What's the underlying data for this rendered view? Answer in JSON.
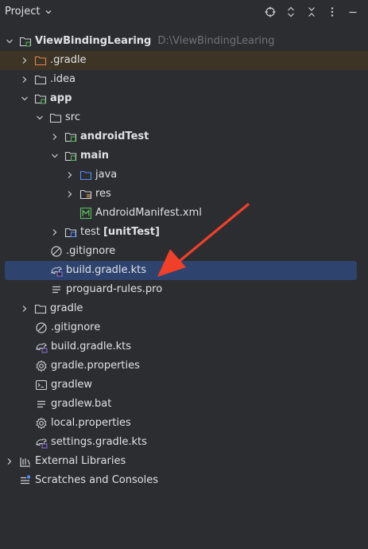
{
  "header": {
    "title": "Project",
    "tools": [
      "locate-icon",
      "expand-all-icon",
      "collapse-all-icon",
      "more-icon",
      "minimize-icon"
    ]
  },
  "tree": {
    "items": [
      {
        "label": "ViewBindingLearing",
        "path": "D:\\ViewBindingLearing",
        "bold": true,
        "icon": "module-folder-icon",
        "arrow": "expanded"
      },
      {
        "label": ".gradle",
        "icon": "folder-orange-icon",
        "arrow": "collapsed"
      },
      {
        "label": ".idea",
        "icon": "folder-icon",
        "arrow": "collapsed"
      },
      {
        "label": "app",
        "icon": "module-folder-icon",
        "arrow": "expanded",
        "bold": true
      },
      {
        "label": "src",
        "icon": "folder-icon",
        "arrow": "expanded"
      },
      {
        "label": "androidTest",
        "icon": "test-folder-icon",
        "arrow": "collapsed",
        "bold": true
      },
      {
        "label": "main",
        "icon": "source-folder-icon",
        "arrow": "expanded",
        "bold": true
      },
      {
        "label": "java",
        "icon": "folder-blue-icon",
        "arrow": "collapsed"
      },
      {
        "label": "res",
        "icon": "res-folder-icon",
        "arrow": "collapsed"
      },
      {
        "label": "AndroidManifest.xml",
        "icon": "manifest-icon"
      },
      {
        "label": "test",
        "suffix": "[unitTest]",
        "icon": "test-folder-icon",
        "arrow": "collapsed"
      },
      {
        "label": ".gitignore",
        "icon": "ignore-icon"
      },
      {
        "label": "build.gradle.kts",
        "icon": "gradle-kts-icon"
      },
      {
        "label": "proguard-rules.pro",
        "icon": "text-file-icon"
      },
      {
        "label": "gradle",
        "icon": "folder-icon",
        "arrow": "collapsed"
      },
      {
        "label": ".gitignore",
        "icon": "ignore-icon"
      },
      {
        "label": "build.gradle.kts",
        "icon": "gradle-kts-icon"
      },
      {
        "label": "gradle.properties",
        "icon": "settings-gear-icon"
      },
      {
        "label": "gradlew",
        "icon": "terminal-icon"
      },
      {
        "label": "gradlew.bat",
        "icon": "text-file-icon"
      },
      {
        "label": "local.properties",
        "icon": "settings-gear-icon"
      },
      {
        "label": "settings.gradle.kts",
        "icon": "gradle-kts-icon"
      },
      {
        "label": "External Libraries",
        "icon": "libraries-icon",
        "arrow": "collapsed"
      },
      {
        "label": "Scratches and Consoles",
        "icon": "scratches-icon"
      }
    ]
  },
  "colors": {
    "background": "#2b2d30",
    "selection": "#2e436e",
    "gradle_highlight": "#3d3425",
    "annotation_arrow": "#f0402a"
  }
}
